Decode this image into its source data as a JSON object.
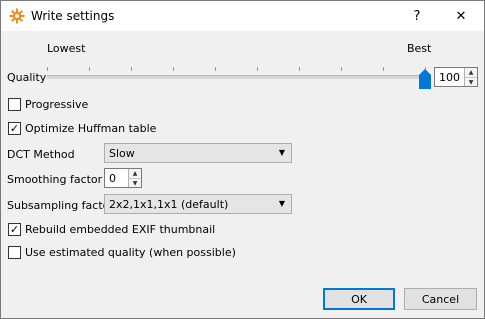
{
  "window": {
    "title": "Write settings",
    "help_label": "?",
    "close_label": "✕"
  },
  "quality": {
    "label": "Quality",
    "min_label": "Lowest",
    "max_label": "Best",
    "value": "100",
    "slider_fraction": 1.0
  },
  "progressive": {
    "label": "Progressive",
    "checked": false
  },
  "optimize_huffman": {
    "label": "Optimize Huffman table",
    "checked": true
  },
  "dct_method": {
    "label": "DCT Method",
    "value": "Slow"
  },
  "smoothing": {
    "label": "Smoothing factor",
    "value": "0"
  },
  "subsampling": {
    "label": "Subsampling factor",
    "value": "2x2,1x1,1x1 (default)"
  },
  "rebuild_exif": {
    "label": "Rebuild embedded EXIF thumbnail",
    "checked": true
  },
  "use_estimated": {
    "label": "Use estimated quality (when possible)",
    "checked": false
  },
  "buttons": {
    "ok": "OK",
    "cancel": "Cancel"
  },
  "colors": {
    "accent": "#0078d7",
    "icon_orange": "#f28c18"
  },
  "icons": [
    "app-gear-icon",
    "help-icon",
    "close-icon",
    "chevron-down-icon",
    "checkmark-icon",
    "spin-up-icon",
    "spin-down-icon"
  ]
}
